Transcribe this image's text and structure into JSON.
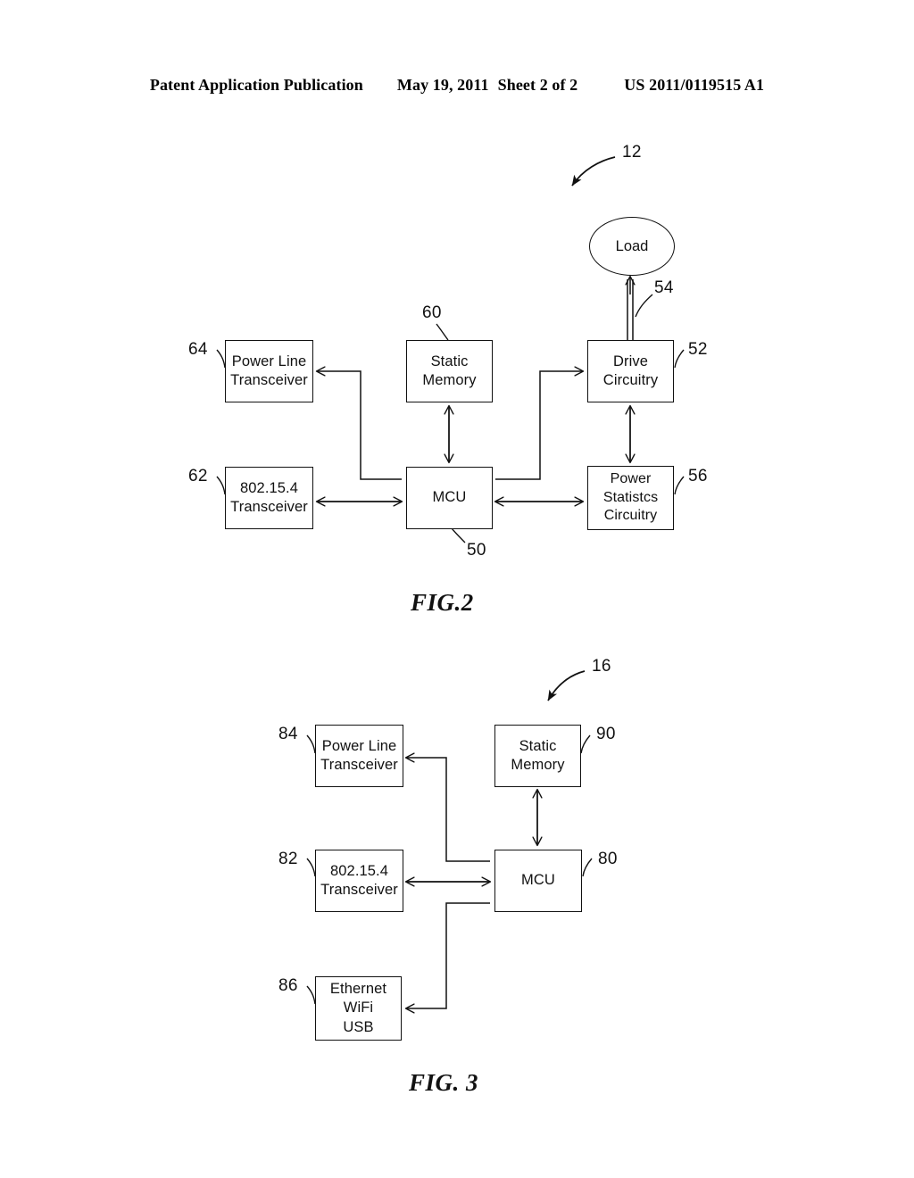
{
  "header": {
    "publication": "Patent Application Publication",
    "date": "May 19, 2011",
    "sheet": "Sheet 2 of 2",
    "docnumber": "US 2011/0119515 A1"
  },
  "figures": [
    {
      "id": "fig2",
      "caption": "FIG.2",
      "assembly_ref": "12",
      "nodes": [
        {
          "name": "power-line-transceiver",
          "ref": "64",
          "lines": [
            "Power Line",
            "Transceiver"
          ]
        },
        {
          "name": "zigbee-transceiver",
          "ref": "62",
          "lines": [
            "802.15.4",
            "Transceiver"
          ]
        },
        {
          "name": "static-memory",
          "ref": "60",
          "lines": [
            "Static",
            "Memory"
          ]
        },
        {
          "name": "mcu",
          "ref": "50",
          "lines": [
            "MCU"
          ]
        },
        {
          "name": "drive-circuitry",
          "ref": "52",
          "lines": [
            "Drive",
            "Circuitry"
          ]
        },
        {
          "name": "power-statistics-circuitry",
          "ref": "56",
          "lines": [
            "Power",
            "Statistcs",
            "Circuitry"
          ]
        },
        {
          "name": "load",
          "ref": "",
          "lines": [
            "Load"
          ]
        }
      ],
      "connector_refs": [
        {
          "name": "load-drive-connector",
          "ref": "54"
        }
      ]
    },
    {
      "id": "fig3",
      "caption": "FIG. 3",
      "assembly_ref": "16",
      "nodes": [
        {
          "name": "power-line-transceiver",
          "ref": "84",
          "lines": [
            "Power Line",
            "Transceiver"
          ]
        },
        {
          "name": "zigbee-transceiver",
          "ref": "82",
          "lines": [
            "802.15.4",
            "Transceiver"
          ]
        },
        {
          "name": "network-interface",
          "ref": "86",
          "lines": [
            "Ethernet",
            "WiFi",
            "USB"
          ]
        },
        {
          "name": "static-memory",
          "ref": "90",
          "lines": [
            "Static",
            "Memory"
          ]
        },
        {
          "name": "mcu",
          "ref": "80",
          "lines": [
            "MCU"
          ]
        }
      ]
    }
  ]
}
